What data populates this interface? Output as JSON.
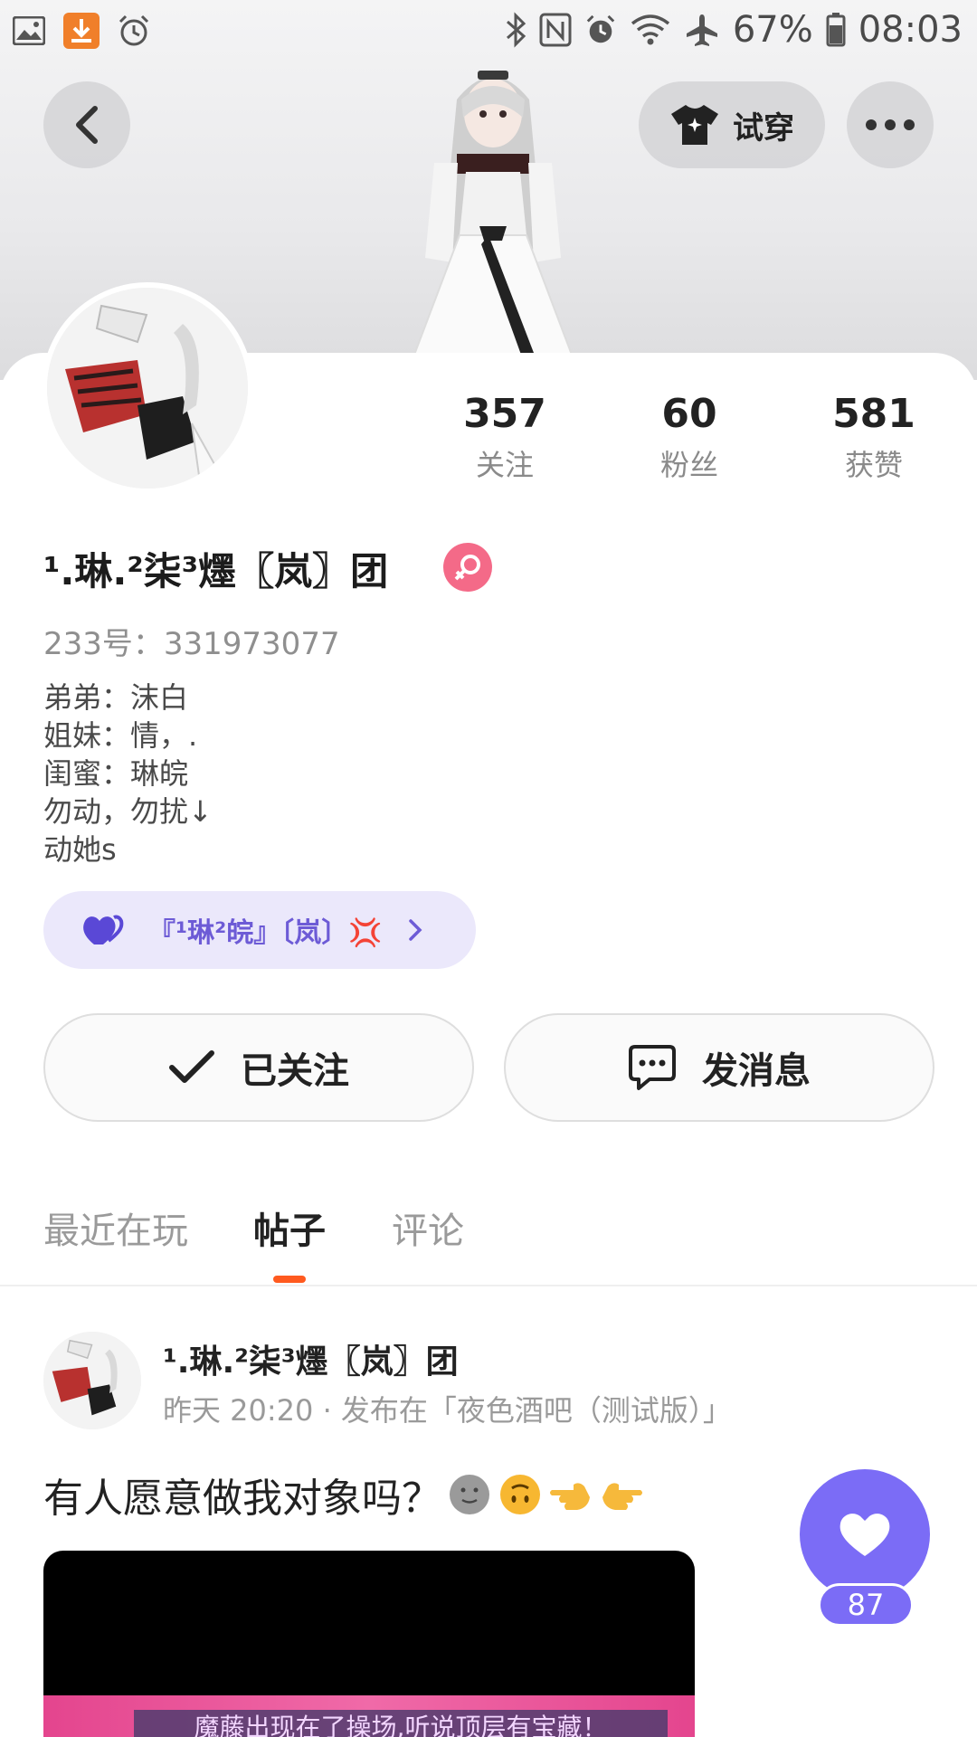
{
  "status_bar": {
    "battery": "67%",
    "time": "08:03"
  },
  "header": {
    "tryon_label": "试穿"
  },
  "stats": [
    {
      "value": "357",
      "label": "关注"
    },
    {
      "value": "60",
      "label": "粉丝"
    },
    {
      "value": "581",
      "label": "获赞"
    }
  ],
  "profile": {
    "nickname": "¹.琳.²柒³爅〖岚〗团",
    "uid": "233号：331973077",
    "bio": [
      "弟弟：沫白",
      "姐妹：情，.",
      "闺蜜：琳皖",
      "勿动，勿扰↓",
      "动她s"
    ]
  },
  "group_chip": {
    "label": "『¹琳²皖』〔岚〕💢"
  },
  "actions": {
    "follow_label": "已关注",
    "message_label": "发消息"
  },
  "tabs": [
    {
      "label": "最近在玩"
    },
    {
      "label": "帖子"
    },
    {
      "label": "评论"
    }
  ],
  "post": {
    "author": "¹.琳.²柒³爅〖岚〗团",
    "meta": "昨天 20:20 · 发布在「夜色酒吧（测试版）」",
    "text": "有人愿意做我对象吗？",
    "media_caption": "魔藤出现在了操场,听说顶层有宝藏！",
    "like_count": "87"
  },
  "colors": {
    "accent": "#ff5a1f",
    "like": "#7b6cf6",
    "gender": "#f46a88",
    "chip_bg": "#ebe8fb"
  }
}
